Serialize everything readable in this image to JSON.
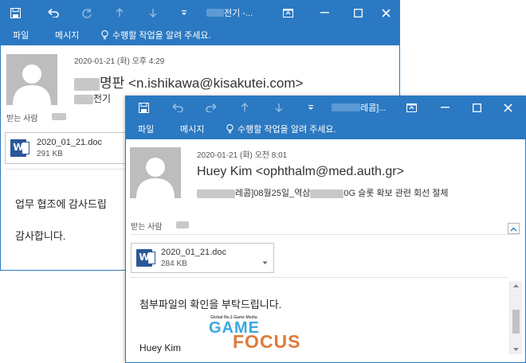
{
  "colors": {
    "title_bar": "#2b79c2",
    "avatar": "#bdbdbd"
  },
  "back_window": {
    "title": "전기 -...",
    "ribbon": {
      "file_tab": "파일",
      "message_tab": "메시지",
      "tell_me": "수행할 작업을 알려 주세요."
    },
    "header": {
      "date": "2020-01-21 (화) 오후 4:29",
      "sender_name": "명판",
      "sender_email": "<n.ishikawa@kisakutei.com>",
      "subject": "전기",
      "to_label": "받는 사람"
    },
    "attachment": {
      "name": "2020_01_21.doc",
      "size": "291 KB"
    },
    "body": {
      "line1": "업무 협조에 감사드립",
      "line2": "감사합니다."
    }
  },
  "front_window": {
    "title": "레콤]...",
    "ribbon": {
      "file_tab": "파일",
      "message_tab": "메시지",
      "tell_me": "수행할 작업을 알려 주세요."
    },
    "header": {
      "date": "2020-01-21 (화) 오전 8:01",
      "sender": "Huey Kim <ophthalm@med.auth.gr>",
      "subject_prefix": "레콤]08월25일_역삼",
      "subject_suffix": "0G 슬롯 확보 관련 회선 절체",
      "to_label": "받는 사람"
    },
    "attachment": {
      "name": "2020_01_21.doc",
      "size": "284 KB"
    },
    "body": {
      "line1": "첨부파일의 확인을 부탁드립니다.",
      "signature": "Huey Kim"
    }
  },
  "watermark": {
    "tagline": "Global No.1 Game Media",
    "word1": "GAME",
    "word2": "FOCUS"
  }
}
